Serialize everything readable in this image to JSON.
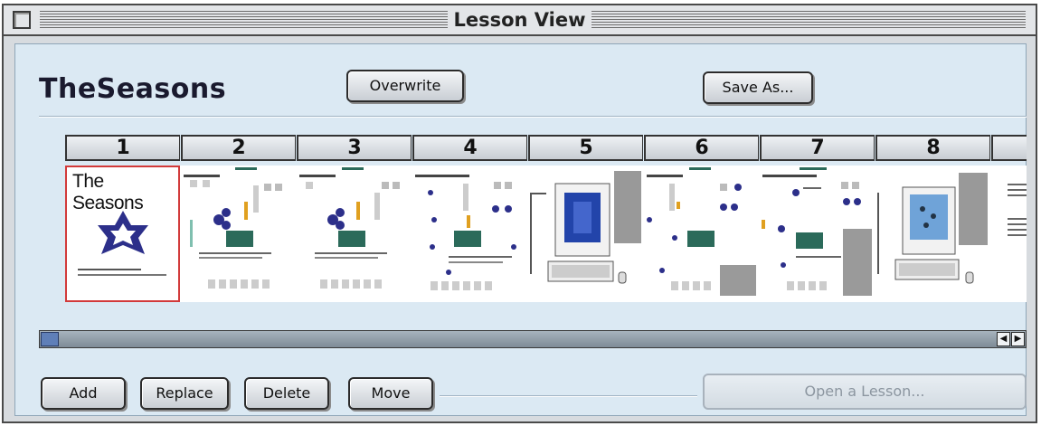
{
  "window": {
    "title": "Lesson View"
  },
  "lesson": {
    "name": "TheSeasons"
  },
  "toolbar": {
    "overwrite_label": "Overwrite",
    "save_as_label": "Save As..."
  },
  "slides": {
    "numbers": [
      "1",
      "2",
      "3",
      "4",
      "5",
      "6",
      "7",
      "8",
      ""
    ],
    "selected": 1,
    "first_title": "The Seasons"
  },
  "actions": {
    "add_label": "Add",
    "replace_label": "Replace",
    "delete_label": "Delete",
    "move_label": "Move",
    "open_lesson_label": "Open a Lesson..."
  },
  "colors": {
    "selection": "#d23a3a",
    "star": "#2c2f8a",
    "accent": "#2b6a5a"
  }
}
